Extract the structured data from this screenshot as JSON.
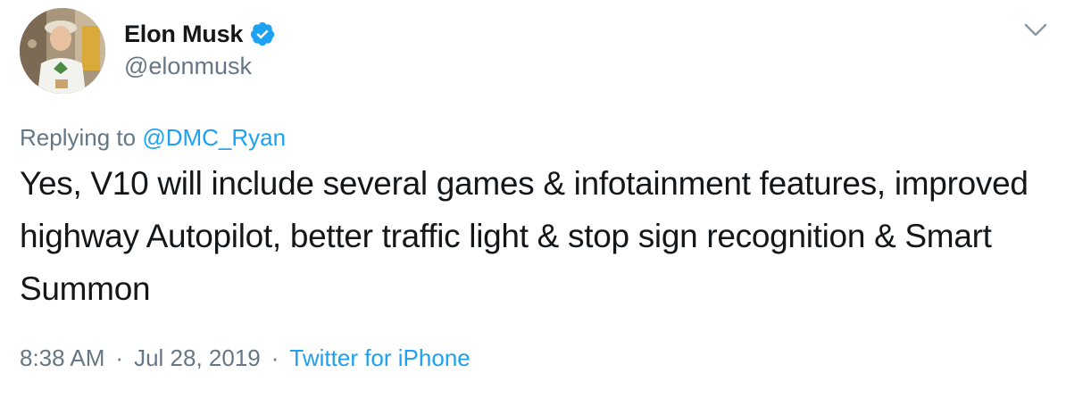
{
  "author": {
    "display_name": "Elon Musk",
    "handle": "@elonmusk",
    "verified": true
  },
  "reply": {
    "prefix": "Replying to",
    "mention": "@DMC_Ryan"
  },
  "tweet": {
    "text": "Yes, V10 will include several games & infotainment features, improved highway Autopilot, better traffic light & stop sign recognition & Smart Summon"
  },
  "meta": {
    "time": "8:38 AM",
    "separator": "·",
    "date": "Jul 28, 2019",
    "source": "Twitter for iPhone"
  },
  "icons": {
    "verified": "verified-badge-icon",
    "menu": "chevron-down-icon"
  },
  "colors": {
    "accent": "#1da1f2",
    "secondary_text": "#657786",
    "primary_text": "#14171a"
  }
}
